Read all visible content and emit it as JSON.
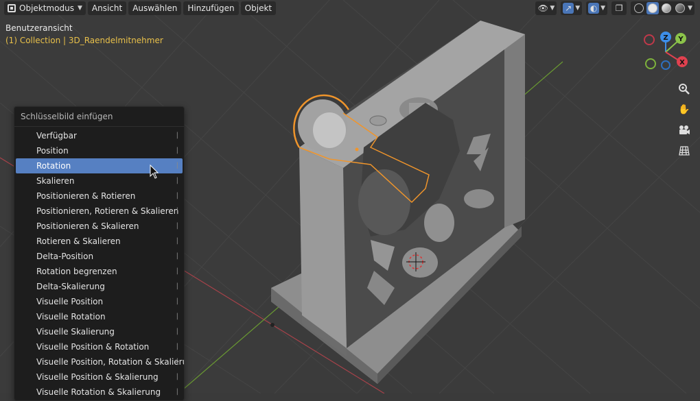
{
  "header": {
    "mode_label": "Objektmodus",
    "menus": [
      "Ansicht",
      "Auswählen",
      "Hinzufügen",
      "Objekt"
    ]
  },
  "overlay": {
    "view_title": "Benutzeransicht",
    "collection_line": "(1) Collection | 3D_Raendelmitnehmer"
  },
  "gizmo": {
    "x_label": "X",
    "y_label": "Y",
    "z_label": "Z"
  },
  "nav_icons": [
    "zoom-icon",
    "pan-hand-icon",
    "camera-icon",
    "grid-view-icon"
  ],
  "menu": {
    "title": "Schlüsselbild einfügen",
    "highlighted_index": 2,
    "items": [
      "Verfügbar",
      "Position",
      "Rotation",
      "Skalieren",
      "Positionieren & Rotieren",
      "Positionieren, Rotieren & Skalieren",
      "Positionieren & Skalieren",
      "Rotieren & Skalieren",
      "Delta-Position",
      "Rotation begrenzen",
      "Delta-Skalierung",
      "Visuelle Position",
      "Visuelle Rotation",
      "Visuelle Skalierung",
      "Visuelle Position & Rotation",
      "Visuelle Position, Rotation & Skalierung",
      "Visuelle Position & Skalierung",
      "Visuelle Rotation & Skalierung"
    ]
  },
  "colors": {
    "highlight": "#5680c2",
    "selection_outline": "#f0952b",
    "collection_text": "#e8c04a",
    "axis_x": "#e0414f",
    "axis_y": "#8bc34a",
    "axis_z": "#3d8ee8"
  }
}
